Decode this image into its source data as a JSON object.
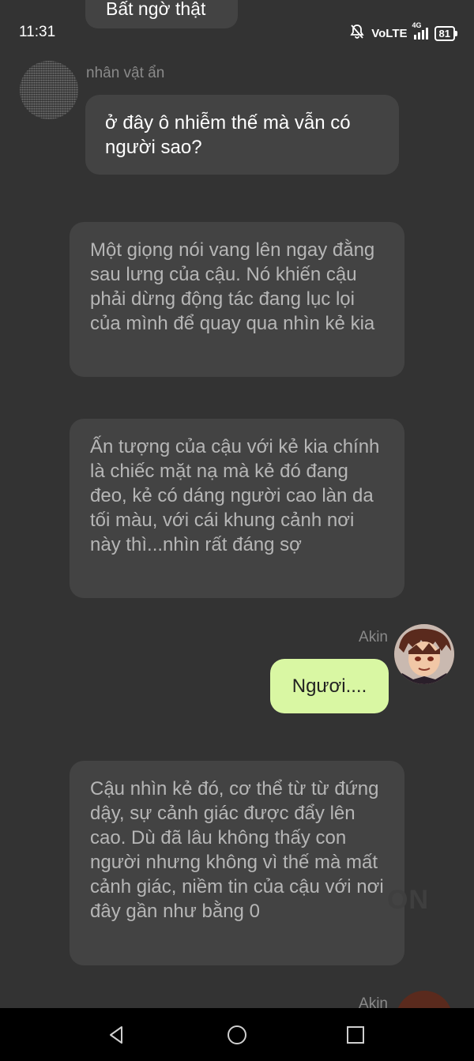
{
  "status_bar": {
    "time": "11:31",
    "network": "VoLTE",
    "signal_label": "4G",
    "battery": "81"
  },
  "messages": {
    "top_partial": "Bất ngờ thật",
    "msg1": {
      "sender": "nhân vật ẩn",
      "text": "ở đây ô nhiễm thế mà vẫn có người sao?"
    },
    "narration1": "Một giọng nói vang lên ngay đằng sau lưng của cậu. Nó khiến cậu phải dừng động tác đang lục lọi của mình để quay qua nhìn kẻ kia",
    "narration2": "Ấn tượng của cậu với kẻ kia chính là chiếc mặt nạ mà kẻ đó đang đeo, kẻ có dáng người cao làn da tối màu, với cái khung cảnh nơi này thì...nhìn rất đáng sợ",
    "msg2": {
      "sender": "Akin",
      "text": "Ngươi...."
    },
    "narration3": "Cậu nhìn kẻ đó, cơ thể từ từ đứng dậy, sự cảnh giác được đẩy lên cao. Dù đã lâu không thấy con người nhưng không vì thế mà mất cảnh giác, niềm tin của cậu với nơi đây gần như bằng 0",
    "bottom_sender": "Akin"
  },
  "watermark": "ON",
  "icons": [
    "mute-bell-icon",
    "signal-icon",
    "battery-icon",
    "back-icon",
    "home-icon",
    "recents-icon"
  ],
  "colors": {
    "background": "#333333",
    "bubble": "#434343",
    "my_bubble": "#d9f7a3",
    "narration_text": "#b6b6b6"
  }
}
